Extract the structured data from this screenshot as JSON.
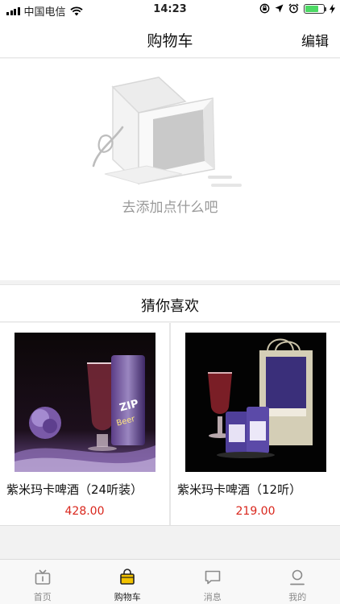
{
  "status_bar": {
    "carrier": "中国电信",
    "time": "14:23"
  },
  "nav": {
    "title": "购物车",
    "edit_label": "编辑"
  },
  "empty_cart": {
    "hint": "去添加点什么吧",
    "icon": "empty-box-icon"
  },
  "recommend": {
    "heading": "猜你喜欢",
    "products": [
      {
        "name": "紫米玛卡啤酒（24听装）",
        "price": "428.00"
      },
      {
        "name": "紫米玛卡啤酒（12听）",
        "price": "219.00"
      }
    ]
  },
  "tabbar": {
    "tabs": [
      {
        "label": "首页",
        "icon": "home-icon"
      },
      {
        "label": "购物车",
        "icon": "cart-icon",
        "active": true
      },
      {
        "label": "消息",
        "icon": "message-icon"
      },
      {
        "label": "我的",
        "icon": "profile-icon"
      }
    ]
  },
  "colors": {
    "price": "#d9261c",
    "active_icon_fill": "#f2c200",
    "battery": "#4cd964"
  }
}
